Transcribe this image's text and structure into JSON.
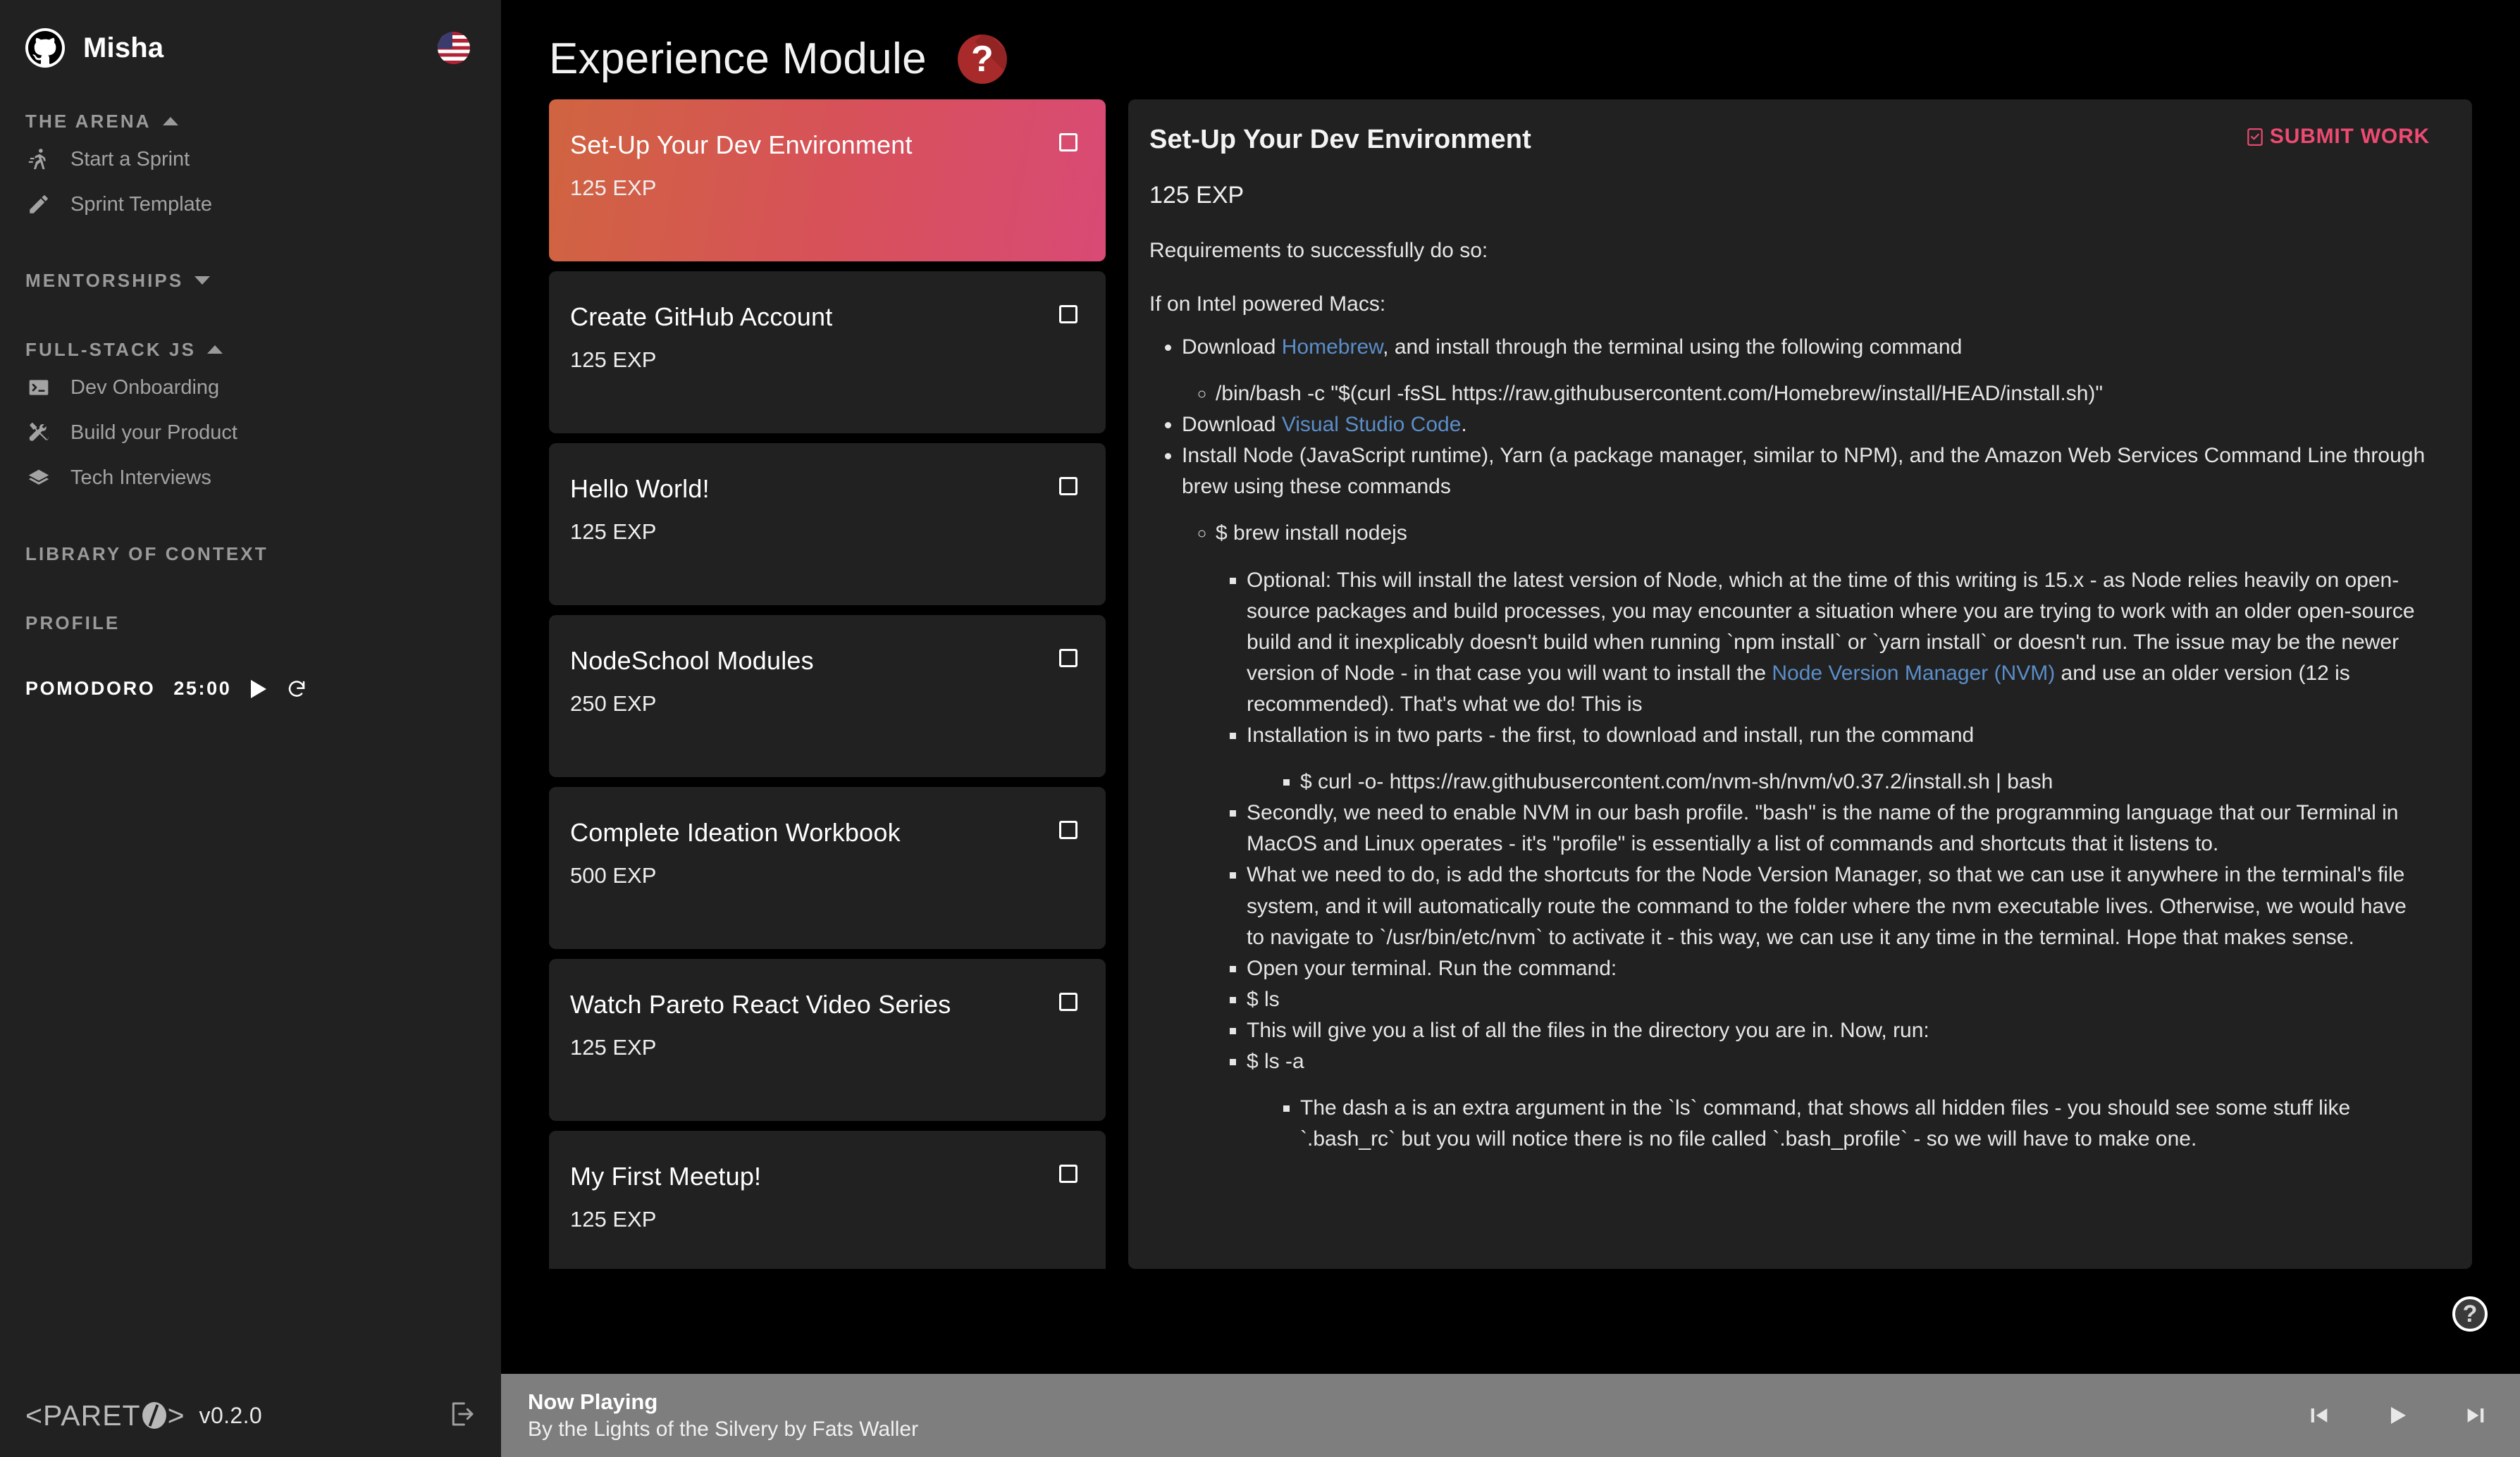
{
  "sidebar": {
    "user": "Misha",
    "avatar_icon": "github-logo-icon",
    "locale_flag": "us-flag-icon",
    "groups": [
      {
        "label": "THE ARENA",
        "caret": "caret-up-icon",
        "items": [
          {
            "label": "Start a Sprint",
            "icon": "running-person-icon"
          },
          {
            "label": "Sprint Template",
            "icon": "pencil-icon"
          }
        ]
      },
      {
        "label": "MENTORSHIPS",
        "caret": "caret-down-icon",
        "items": []
      },
      {
        "label": "FULL-STACK JS",
        "caret": "caret-up-icon",
        "items": [
          {
            "label": "Dev Onboarding",
            "icon": "terminal-icon"
          },
          {
            "label": "Build your Product",
            "icon": "tools-icon"
          },
          {
            "label": "Tech Interviews",
            "icon": "layers-icon"
          }
        ]
      },
      {
        "label": "LIBRARY OF CONTEXT",
        "caret": "",
        "items": []
      },
      {
        "label": "PROFILE",
        "caret": "",
        "items": []
      }
    ],
    "pomodoro": {
      "label": "POMODORO",
      "time": "25:00",
      "play_icon": "play-icon",
      "reset_icon": "refresh-icon"
    },
    "footer": {
      "brand_left": "<PARET",
      "brand_right": ">",
      "version": "v0.2.0",
      "logout_icon": "logout-icon"
    }
  },
  "header": {
    "title": "Experience Module",
    "help_icon": "question-mark-icon",
    "help_glyph": "?"
  },
  "cards": [
    {
      "title": "Set-Up Your Dev Environment",
      "exp": "125 EXP",
      "active": true
    },
    {
      "title": "Create GitHub Account",
      "exp": "125 EXP",
      "active": false
    },
    {
      "title": "Hello World!",
      "exp": "125 EXP",
      "active": false
    },
    {
      "title": "NodeSchool Modules",
      "exp": "250 EXP",
      "active": false
    },
    {
      "title": "Complete Ideation Workbook",
      "exp": "500 EXP",
      "active": false
    },
    {
      "title": "Watch Pareto React Video Series",
      "exp": "125 EXP",
      "active": false
    },
    {
      "title": "My First Meetup!",
      "exp": "125 EXP",
      "active": false
    }
  ],
  "detail": {
    "title": "Set-Up Your Dev Environment",
    "submit_label": "SUBMIT WORK",
    "submit_icon": "clipboard-check-icon",
    "exp": "125 EXP",
    "requirements_intro": "Requirements to successfully do so:",
    "section_intro": "If on Intel powered Macs:",
    "b1_pre": "Download ",
    "b1_link": "Homebrew",
    "b1_post": ", and install through the terminal using the following command",
    "b1_sub": "/bin/bash -c \"$(curl -fsSL https://raw.githubusercontent.com/Homebrew/install/HEAD/install.sh)\"",
    "b2_pre": "Download ",
    "b2_link": "Visual Studio Code",
    "b2_post": ".",
    "b3": "Install Node (JavaScript runtime), Yarn (a package manager, similar to NPM), and the Amazon Web Services Command Line through brew using these commands",
    "b3_sub": "$ brew install nodejs",
    "opt_pre": "Optional: This will install the latest version of Node, which at the time of this writing is 15.x - as Node relies heavily on open-source packages and build processes, you may encounter a situation where you are trying to work with an older open-source build and it inexplicably doesn't build when running `npm install` or `yarn install` or doesn't run. The issue may be the newer version of Node - in that case you will want to install the ",
    "opt_link": "Node Version Manager (NVM)",
    "opt_post": " and use an older version (12 is recommended). That's what we do! This is",
    "install2": "Installation is in two parts - the first, to download and install, run the command",
    "install2_sub": "$ curl -o- https://raw.githubusercontent.com/nvm-sh/nvm/v0.37.2/install.sh | bash",
    "secondly": "Secondly, we need to enable NVM in our bash profile. \"bash\" is the name of the programming language that our Terminal in MacOS and Linux operates - it's \"profile\" is essentially a list of commands and shortcuts that it listens to.",
    "whatwedo": "What we need to do, is add the shortcuts for the Node Version Manager, so that we can use it anywhere in the terminal's file system, and it will automatically route the command to the folder where the nvm executable lives. Otherwise, we would have to navigate to `/usr/bin/etc/nvm` to activate it - this way, we can use it any time in the terminal. Hope that makes sense.",
    "openterm": "Open your terminal. Run the command:",
    "cmd_ls": "$ ls",
    "listfiles": "This will give you a list of all the files in the directory you are in. Now, run:",
    "cmd_ls_a": "$ ls -a",
    "dash_a": "The dash a is an extra argument in the `ls` command, that shows all hidden files - you should see some stuff like `.bash_rc` but you will notice there is no file called `.bash_profile` - so we will have to make one."
  },
  "float_help": {
    "icon": "question-circle-icon",
    "glyph": "?"
  },
  "player": {
    "now_playing": "Now Playing",
    "track": "By the Lights of the Silvery by Fats Waller",
    "prev_icon": "skip-previous-icon",
    "play_icon": "play-icon",
    "next_icon": "skip-next-icon"
  },
  "colors": {
    "accent_pink": "#ef4a72",
    "card_gradient_start": "#d06440",
    "card_gradient_end": "#d94a75",
    "link": "#5b8ec9",
    "panel": "#212121",
    "background": "#000000",
    "player_bar": "#7e7e7e",
    "help_badge": "#a82a2a"
  }
}
